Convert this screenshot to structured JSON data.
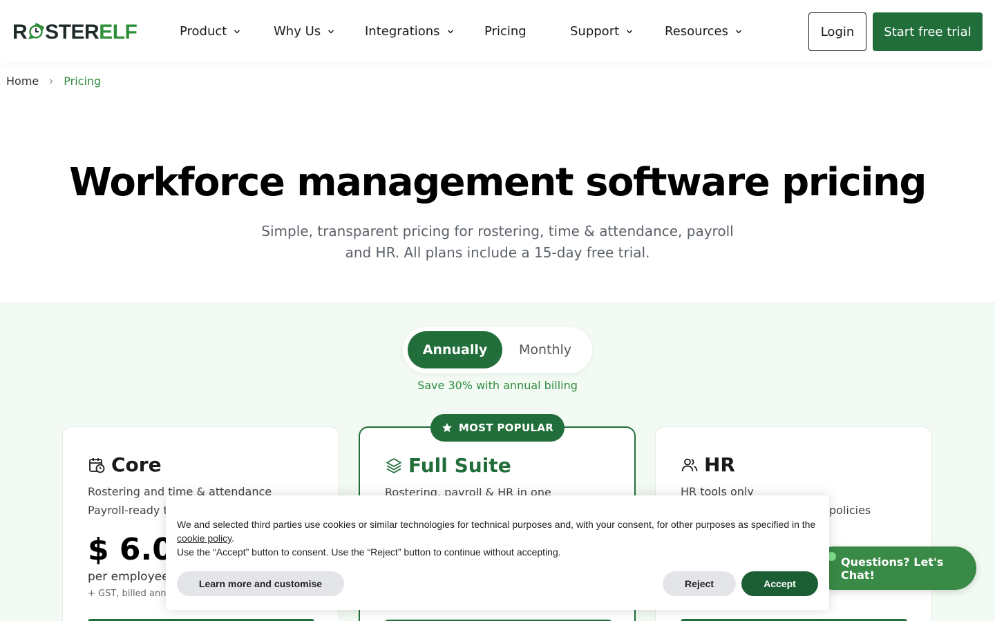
{
  "brand": {
    "logo_part1": "R",
    "logo_part2": "STER",
    "logo_part3": "ELF"
  },
  "nav": {
    "items": [
      {
        "label": "Product",
        "has_dropdown": true
      },
      {
        "label": "Why Us",
        "has_dropdown": true
      },
      {
        "label": "Integrations",
        "has_dropdown": true
      },
      {
        "label": "Pricing",
        "has_dropdown": false
      },
      {
        "label": "Support",
        "has_dropdown": true
      },
      {
        "label": "Resources",
        "has_dropdown": true
      }
    ],
    "login_label": "Login",
    "trial_label": "Start free trial"
  },
  "breadcrumb": {
    "home": "Home",
    "current": "Pricing"
  },
  "hero": {
    "title": "Workforce management software pricing",
    "subtitle_line1": "Simple, transparent pricing for rostering, time & attendance, payroll",
    "subtitle_line2": "and HR. All plans include a 15-day free trial."
  },
  "billing": {
    "annually_label": "Annually",
    "monthly_label": "Monthly",
    "selected": "Annually",
    "save_note": "Save 30% with annual billing"
  },
  "badge": {
    "popular_label": "MOST POPULAR",
    "icon": "star-icon"
  },
  "plans": [
    {
      "name": "Core",
      "icon": "calendar-clock-icon",
      "desc_line1": "Rostering and time & attendance",
      "desc_line2": "Payroll-ready t",
      "price": "$ 6.00",
      "per": "per employee",
      "gst": "+ GST, billed ann"
    },
    {
      "name": "Full Suite",
      "icon": "layers-icon",
      "desc_line1": "Rostering, payroll & HR in one",
      "desc_line2": ""
    },
    {
      "name": "HR",
      "icon": "users-icon",
      "desc_line1": "HR tools only",
      "desc_line2": "policies"
    }
  ],
  "chat": {
    "label": "Questions? Let's Chat!"
  },
  "cookie": {
    "text_before_link": "We and selected third parties use cookies or similar technologies for technical purposes and, with your consent, for other purposes as specified in the",
    "link_text": "cookie policy",
    "text_after_link": ".",
    "text_line2": "Use the “Accept” button to consent. Use the “Reject” button to continue without accepting.",
    "learn_label": "Learn more and customise",
    "reject_label": "Reject",
    "accept_label": "Accept"
  },
  "colors": {
    "brand_green": "#226e3a",
    "accent_green": "#2f8a3e",
    "section_bg": "#f2faf3"
  }
}
